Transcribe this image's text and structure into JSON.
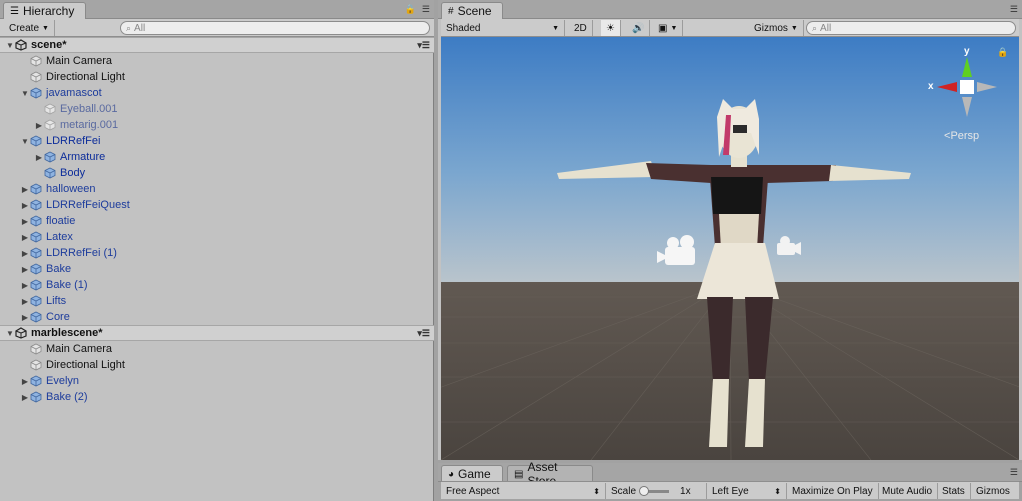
{
  "hierarchy": {
    "tab_title": "Hierarchy",
    "create_label": "Create",
    "search_placeholder": "All",
    "rows": [
      {
        "label": "scene*",
        "depth": 0,
        "kind": "scene",
        "fold": "open"
      },
      {
        "label": "Main Camera",
        "depth": 1,
        "kind": "object",
        "fold": "none"
      },
      {
        "label": "Directional Light",
        "depth": 1,
        "kind": "object",
        "fold": "none"
      },
      {
        "label": "javamascot",
        "depth": 1,
        "kind": "prefab",
        "fold": "open"
      },
      {
        "label": "Eyeball.001",
        "depth": 2,
        "kind": "prefab-dim",
        "fold": "none"
      },
      {
        "label": "metarig.001",
        "depth": 2,
        "kind": "prefab-dim",
        "fold": "closed"
      },
      {
        "label": "LDRRefFei",
        "depth": 1,
        "kind": "prefab-sel",
        "fold": "open"
      },
      {
        "label": "Armature",
        "depth": 2,
        "kind": "prefab-sel",
        "fold": "closed"
      },
      {
        "label": "Body",
        "depth": 2,
        "kind": "prefab-sel",
        "fold": "none"
      },
      {
        "label": "halloween",
        "depth": 1,
        "kind": "prefab",
        "fold": "closed"
      },
      {
        "label": "LDRRefFeiQuest",
        "depth": 1,
        "kind": "prefab",
        "fold": "closed"
      },
      {
        "label": "floatie",
        "depth": 1,
        "kind": "prefab",
        "fold": "closed"
      },
      {
        "label": "Latex",
        "depth": 1,
        "kind": "prefab",
        "fold": "closed"
      },
      {
        "label": "LDRRefFei (1)",
        "depth": 1,
        "kind": "prefab",
        "fold": "closed"
      },
      {
        "label": "Bake",
        "depth": 1,
        "kind": "prefab",
        "fold": "closed"
      },
      {
        "label": "Bake (1)",
        "depth": 1,
        "kind": "prefab",
        "fold": "closed"
      },
      {
        "label": "Lifts",
        "depth": 1,
        "kind": "prefab",
        "fold": "closed"
      },
      {
        "label": "Core",
        "depth": 1,
        "kind": "prefab",
        "fold": "closed"
      },
      {
        "label": "marblescene*",
        "depth": 0,
        "kind": "scene",
        "fold": "open"
      },
      {
        "label": "Main Camera",
        "depth": 1,
        "kind": "object",
        "fold": "none"
      },
      {
        "label": "Directional Light",
        "depth": 1,
        "kind": "object",
        "fold": "none"
      },
      {
        "label": "Evelyn",
        "depth": 1,
        "kind": "prefab",
        "fold": "closed"
      },
      {
        "label": "Bake (2)",
        "depth": 1,
        "kind": "prefab",
        "fold": "closed"
      }
    ]
  },
  "scene": {
    "tab_title": "Scene",
    "shading_mode": "Shaded",
    "mode_2d": "2D",
    "gizmos_label": "Gizmos",
    "search_placeholder": "All",
    "persp_label": "Persp",
    "axis_x": "x",
    "axis_y": "y",
    "sky_color": "#4a87c8",
    "ground_color": "#4f4a44"
  },
  "game": {
    "tab_title": "Game",
    "asset_store_tab": "Asset Store",
    "aspect": "Free Aspect",
    "scale_label": "Scale",
    "scale_value": "1x",
    "eye": "Left Eye",
    "maximize_label": "Maximize On Play",
    "mute_label": "Mute Audio",
    "stats_label": "Stats",
    "gizmos_label": "Gizmos"
  }
}
